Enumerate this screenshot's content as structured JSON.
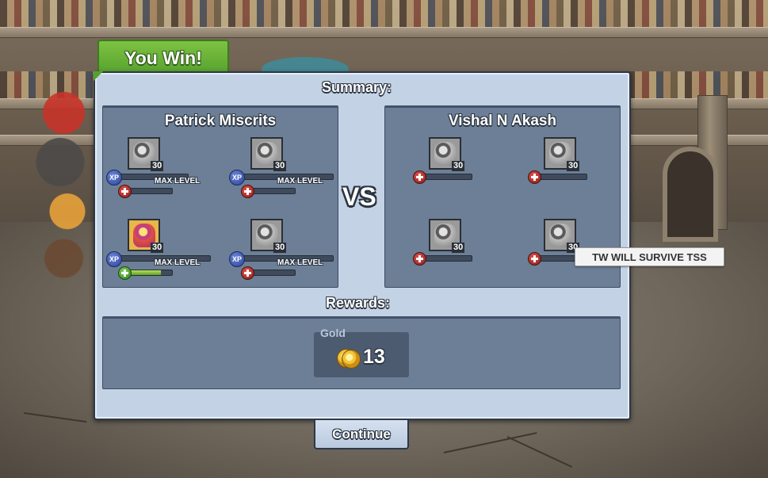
{
  "result_tab": {
    "label": "You Win!"
  },
  "summary": {
    "heading": "Summary:",
    "vs_label": "VS"
  },
  "player": {
    "name": "Patrick Miscrits",
    "miscrits": [
      {
        "level": "30",
        "xp_badge": "XP",
        "xp_label": "MAX LEVEL",
        "hp_fraction": 0.0,
        "portrait": "grey-miscrit",
        "hp_icon": "red-plus-icon"
      },
      {
        "level": "30",
        "xp_badge": "XP",
        "xp_label": "MAX LEVEL",
        "hp_fraction": 0.0,
        "portrait": "grey-miscrit",
        "hp_icon": "red-plus-icon"
      },
      {
        "level": "30",
        "xp_badge": "XP",
        "xp_label": "MAX LEVEL",
        "hp_fraction": 0.75,
        "portrait": "color-miscrit",
        "hp_icon": "green-plus-icon"
      },
      {
        "level": "30",
        "xp_badge": "XP",
        "xp_label": "MAX LEVEL",
        "hp_fraction": 0.0,
        "portrait": "grey-miscrit",
        "hp_icon": "red-plus-icon"
      }
    ]
  },
  "opponent": {
    "name": "Vishal N Akash",
    "miscrits": [
      {
        "level": "30",
        "hp_fraction": 0.0,
        "portrait": "grey-miscrit",
        "hp_icon": "red-plus-icon"
      },
      {
        "level": "30",
        "hp_fraction": 0.0,
        "portrait": "grey-miscrit",
        "hp_icon": "red-plus-icon"
      },
      {
        "level": "30",
        "hp_fraction": 0.0,
        "portrait": "grey-miscrit",
        "hp_icon": "red-plus-icon"
      },
      {
        "level": "30",
        "hp_fraction": 0.0,
        "portrait": "grey-miscrit",
        "hp_icon": "red-plus-icon"
      }
    ]
  },
  "tooltip": {
    "text": "TW WILL SURVIVE TSS"
  },
  "rewards": {
    "heading": "Rewards:",
    "gold_label": "Gold",
    "gold_value": "13",
    "gold_icon": "gold-coin-icon"
  },
  "continue_button": {
    "label": "Continue"
  },
  "colors": {
    "win_tab": "#56a12e",
    "panel": "#c4d2e6",
    "team_box": "#6c7f97",
    "hp_fill": "#8bc53f"
  }
}
